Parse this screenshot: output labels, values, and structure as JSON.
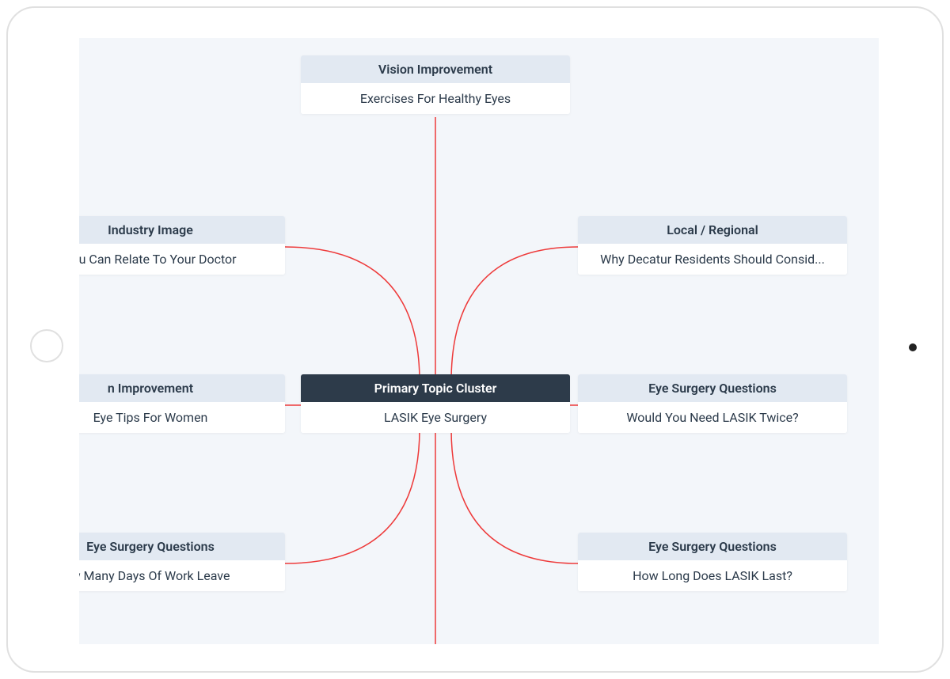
{
  "center": {
    "header": "Primary Topic Cluster",
    "body": "LASIK Eye Surgery"
  },
  "top": {
    "header": "Vision Improvement",
    "body": "Exercises For Healthy Eyes"
  },
  "topleft": {
    "header": "Industry Image",
    "body": "You Can Relate To Your Doctor"
  },
  "midleft": {
    "header": "n Improvement",
    "body": "Eye Tips For Women"
  },
  "botleft": {
    "header": "Eye Surgery Questions",
    "body": "w Many Days Of Work Leave"
  },
  "topright": {
    "header": "Local / Regional",
    "body": "Why Decatur Residents Should Consid..."
  },
  "midright": {
    "header": "Eye Surgery Questions",
    "body": "Would You Need LASIK Twice?"
  },
  "botright": {
    "header": "Eye Surgery Questions",
    "body": "How Long Does LASIK Last?"
  },
  "colors": {
    "connector": "#ee3a3a",
    "headerLight": "#e2e9f2",
    "headerDark": "#2d3b4a",
    "screenBg": "#f3f6fa"
  }
}
